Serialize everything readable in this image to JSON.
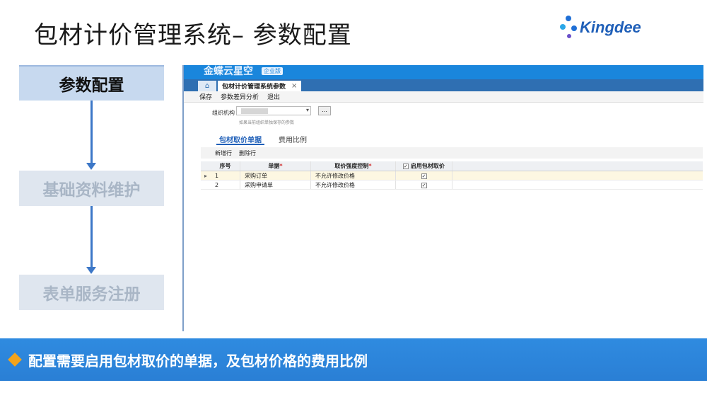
{
  "slide": {
    "title": "包材计价管理系统– 参数配置",
    "brand": "Kingdee",
    "colors": {
      "accent": "#2f8be0",
      "step_active": "#c7d9ef",
      "arrow": "#3c77c7",
      "diamond": "#f3a31b"
    }
  },
  "steps": [
    {
      "label": "参数配置",
      "state": "active"
    },
    {
      "label": "基础资料维护",
      "state": "inactive"
    },
    {
      "label": "表单服务注册",
      "state": "inactive"
    }
  ],
  "app": {
    "name": "金蝶云星空",
    "edition": "企业版",
    "home_icon": "home-icon",
    "tab_title": "包材计价管理系统参数",
    "tab_close": "×",
    "toolbar": [
      "保存",
      "参数差异分析",
      "退出"
    ],
    "org_label": "组织机构",
    "org_caret": "▾",
    "browse_label": "...",
    "hint": "如果当前组织单独保存的参数",
    "subtabs": [
      "包材取价单据",
      "费用比例"
    ],
    "grid_toolbar": [
      "新增行",
      "删除行"
    ],
    "grid": {
      "headers": {
        "no": "序号",
        "bill": "单据",
        "control": "取价强度控制",
        "enable": "启用包材取价",
        "required": "*",
        "header_check": "✓"
      },
      "rows": [
        {
          "indicator": "▸",
          "no": "1",
          "bill": "采购订单",
          "control": "不允许修改价格",
          "enabled": "✓"
        },
        {
          "indicator": "",
          "no": "2",
          "bill": "采购申请单",
          "control": "不允许修改价格",
          "enabled": "✓"
        }
      ]
    }
  },
  "footer": {
    "text": "配置需要启用包材取价的单据，及包材价格的费用比例"
  }
}
